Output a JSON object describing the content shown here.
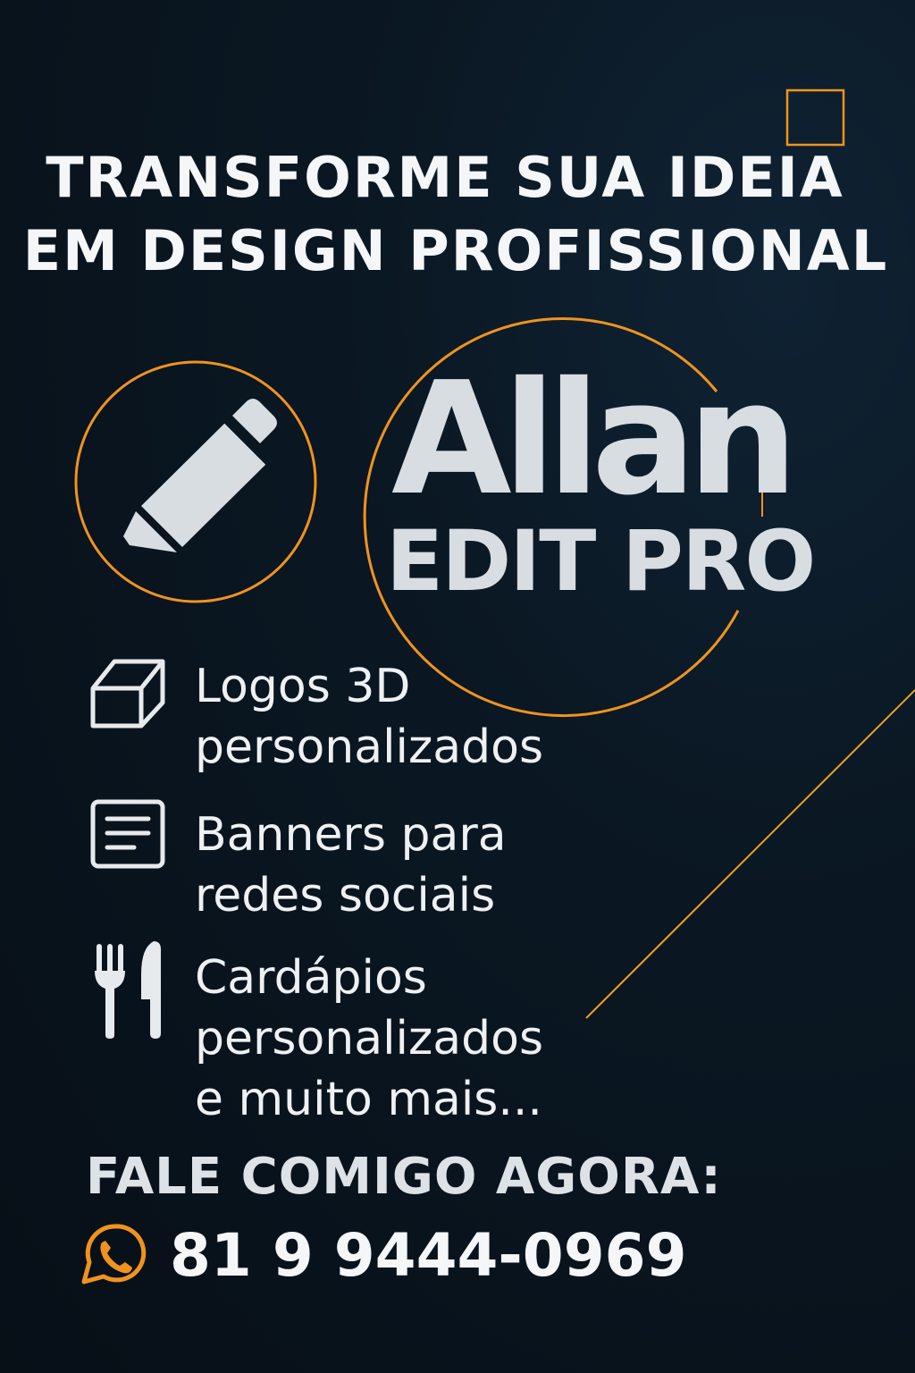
{
  "headline": {
    "line1": "TRANSFORME SUA IDEIA",
    "line2": "EM DESIGN PROFISSIONAL"
  },
  "brand": {
    "name": "Allan",
    "subtitle": "EDIT PRO"
  },
  "services": [
    {
      "icon": "cube-icon",
      "lines": [
        "Logos 3D",
        "personalizados"
      ]
    },
    {
      "icon": "document-icon",
      "lines": [
        "Banners para",
        "redes sociais"
      ]
    },
    {
      "icon": "fork-knife-icon",
      "lines": [
        "Cardápios",
        "personalizados",
        "e muito mais..."
      ]
    }
  ],
  "contact": {
    "cta": "FALE COMIGO AGORA:",
    "icon": "whatsapp-icon",
    "phone": "81 9 9444-0969"
  },
  "colors": {
    "background": "#0a1722",
    "accent": "#f0931e",
    "text": "#eef1f3",
    "brand_text": "#d8dde2"
  }
}
